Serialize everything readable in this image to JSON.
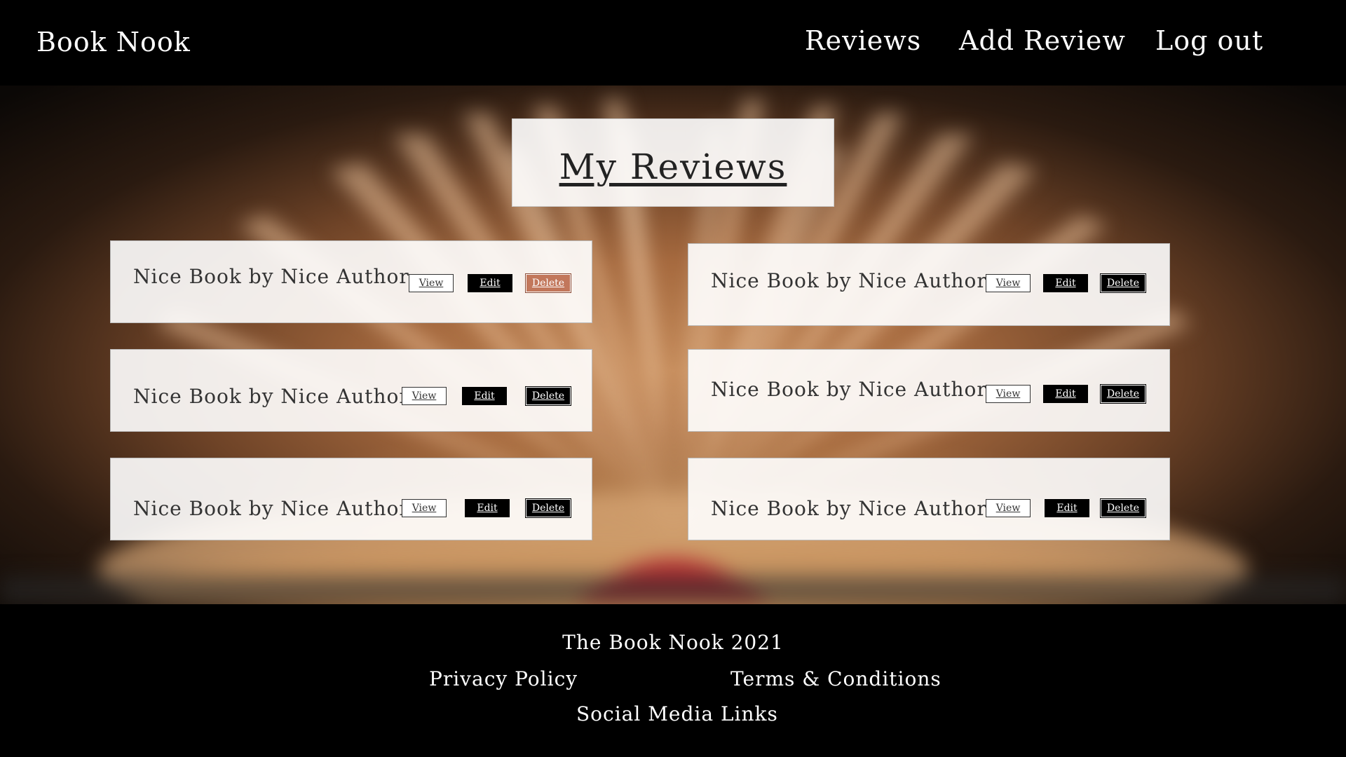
{
  "header": {
    "brand": "Book Nook",
    "nav": {
      "reviews": "Reviews",
      "add_review": "Add Review",
      "log_out": "Log out"
    }
  },
  "main": {
    "title": "My Reviews",
    "reviews": [
      {
        "title": "Nice Book by Nice Author",
        "view": "View",
        "edit": "Edit",
        "delete": "Delete"
      },
      {
        "title": "Nice Book by Nice Author",
        "view": "View",
        "edit": "Edit",
        "delete": "Delete"
      },
      {
        "title": "Nice Book by Nice Author",
        "view": "View",
        "edit": "Edit",
        "delete": "Delete"
      },
      {
        "title": "Nice Book by Nice Author",
        "view": "View",
        "edit": "Edit",
        "delete": "Delete"
      },
      {
        "title": "Nice Book by Nice Author",
        "view": "View",
        "edit": "Edit",
        "delete": "Delete"
      },
      {
        "title": "Nice Book by Nice Author",
        "view": "View",
        "edit": "Edit",
        "delete": "Delete"
      }
    ]
  },
  "footer": {
    "copyright": "The Book Nook 2021",
    "privacy": "Privacy Policy",
    "terms": "Terms & Conditions",
    "social": "Social Media Links"
  },
  "colors": {
    "header_bg": "#000000",
    "delete_hover": "#c2775b",
    "card_bg": "#ffffff"
  }
}
